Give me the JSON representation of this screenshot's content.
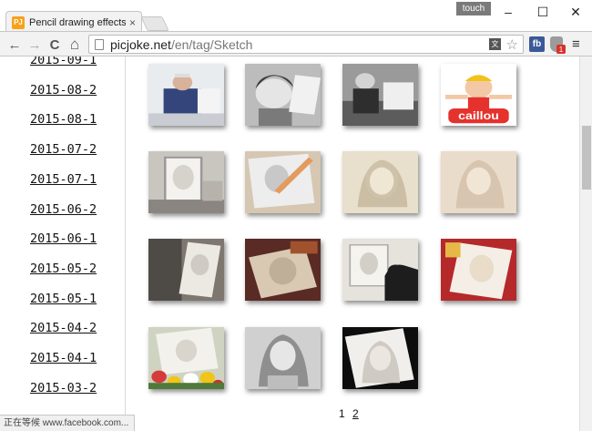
{
  "window": {
    "tab_title": "Pencil drawing effects fo",
    "tab_favicon": "PJ",
    "tab_close": "×",
    "touch_label": "touch",
    "minimize": "–",
    "maximize": "☐",
    "close": "✕"
  },
  "toolbar": {
    "back": "←",
    "forward": "→",
    "reload": "C",
    "home": "⌂",
    "url_host": "picjoke.net",
    "url_path": "/en/tag/Sketch",
    "translate": "文",
    "star": "☆",
    "fb": "fb",
    "ext_badge": "1",
    "menu": "≡"
  },
  "sidebar": {
    "dates": [
      "2015-09-1",
      "2015-08-2",
      "2015-08-1",
      "2015-07-2",
      "2015-07-1",
      "2015-06-2",
      "2015-06-1",
      "2015-05-2",
      "2015-05-1",
      "2015-04-2",
      "2015-04-1",
      "2015-03-2"
    ]
  },
  "thumbnails": [
    {
      "label": "man-in-suit-sketching"
    },
    {
      "label": "girl-portrait-pencil"
    },
    {
      "label": "man-drawing-at-desk"
    },
    {
      "label": "caillou-cartoon"
    },
    {
      "label": "framed-sketch-on-table"
    },
    {
      "label": "sketch-with-pencil"
    },
    {
      "label": "woman-portrait-sepia"
    },
    {
      "label": "woman-portrait-sepia-soft"
    },
    {
      "label": "person-holding-sketch"
    },
    {
      "label": "sketch-on-red-table"
    },
    {
      "label": "sketch-with-dog"
    },
    {
      "label": "sketch-on-red-background"
    },
    {
      "label": "sketch-with-flowers"
    },
    {
      "label": "woman-portrait-gray"
    },
    {
      "label": "tilted-sketch-on-black"
    }
  ],
  "caillou_text": "caillou",
  "pagination": {
    "current": "1",
    "next": "2"
  },
  "status": "正在等候 www.facebook.com..."
}
